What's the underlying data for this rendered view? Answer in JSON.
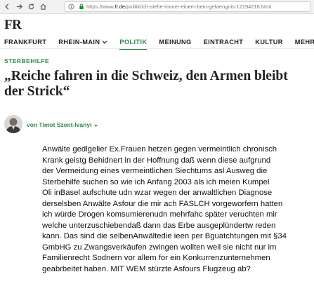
{
  "browser": {
    "url_prefix": "https://www.",
    "url_domain": "fr.de",
    "url_path": "/politik/ich-stehe-immer-einem-bein-gefaengnis-12194216.html"
  },
  "site": {
    "logo": "FR"
  },
  "nav": {
    "items": [
      {
        "label": "FRANKFURT",
        "has_caret": false,
        "active": false
      },
      {
        "label": "RHEIN-MAIN",
        "has_caret": true,
        "active": false
      },
      {
        "label": "POLITIK",
        "has_caret": false,
        "active": true
      },
      {
        "label": "MEINUNG",
        "has_caret": false,
        "active": false
      },
      {
        "label": "EINTRACHT",
        "has_caret": false,
        "active": false
      },
      {
        "label": "KULTUR",
        "has_caret": false,
        "active": false
      },
      {
        "label": "MEHR",
        "has_caret": true,
        "active": false
      }
    ]
  },
  "article": {
    "kicker": "STERBEHILFE",
    "headline": "„Reiche fahren in die Schweiz, den Armen bleibt der Strick“",
    "author": "von Timot Szent-Ivanyi",
    "body": "Anwälte gedlgelier Ex.Frauen hetzen gegen vermeintlich chronisch\nKrank geistg Behidnert in der Hoffnung daß wenn diese aufgrund\nder Vermeidung eines vermeintlichen Siechtums asl Ausweg die\nSterbehilfe suchen so wie ich Anfang 2003 als ich meien Kumpel\nOli inBasel aufschute udn wzar wegen der anwaltlichen Diagnose\nderselsben Anwälte Asfour  die mir ach FASLCH vorgeworfern hatten\n ich würde Drogen komsumierenudn mehrfahc später veruchten mir\nwelche unterzuschiebendaß dann das Erbe ausgeplündertw reden\nkann. Das sind die selbenAnwältedie ieen per Bguatchtungen mit §34\nGmbHG zu Zwangsverkäufen zwingen wollten weil sie nicht nur im\nFamilienrecht Sodnern vor allem for ein Konkurrenzunternehmen\ngeabrbeitet haben. MIT WEM stürzte Asfours Flugzeug ab?"
  },
  "colors": {
    "accent": "#2e8a4a",
    "text": "#222222"
  }
}
